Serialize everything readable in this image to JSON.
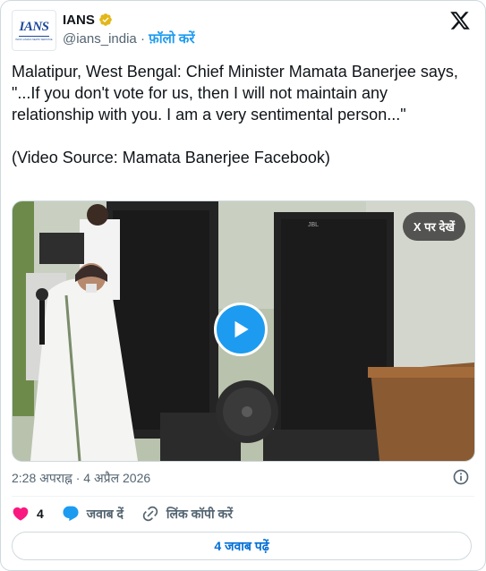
{
  "account": {
    "name": "IANS",
    "handle": "@ians_india",
    "separator": " · ",
    "follow_label": "फ़ॉलो करें",
    "logo_text": "IANS",
    "logo_subtext": "INDO-ASIAN NEWS SERVICE"
  },
  "tweet": {
    "text": "Malatipur, West Bengal: Chief Minister Mamata Banerjee says, \"...If you don't vote for us, then I will not maintain any relationship with you. I am a very sentimental person...\"\n\n(Video Source: Mamata Banerjee Facebook)"
  },
  "media": {
    "view_on_x_label": "X पर देखें",
    "poster_speaker_text": "JBL"
  },
  "meta": {
    "timestamp": "2:28 अपराह्न · 4 अप्रैल 2026"
  },
  "actions": {
    "like_count": "4",
    "reply_label": "जवाब दें",
    "copy_link_label": "लिंक कॉपी करें"
  },
  "replies_button": {
    "label": "4 जवाब पढ़ें"
  },
  "colors": {
    "accent": "#1d9bf0",
    "like": "#f91880",
    "verified": "#e2b719",
    "text_secondary": "#536471"
  }
}
